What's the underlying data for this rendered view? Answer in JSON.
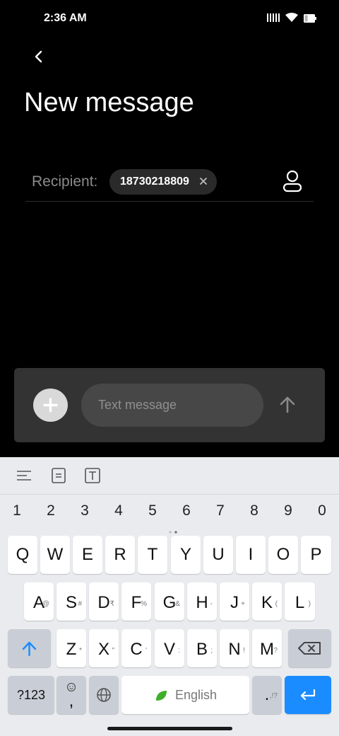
{
  "status_bar": {
    "time": "2:36 AM"
  },
  "header": {
    "title": "New message"
  },
  "recipient": {
    "label": "Recipient:",
    "chip_number": "18730218809"
  },
  "composer": {
    "placeholder": "Text message"
  },
  "keyboard": {
    "numbers": [
      "1",
      "2",
      "3",
      "4",
      "5",
      "6",
      "7",
      "8",
      "9",
      "0"
    ],
    "row1": [
      {
        "key": "Q",
        "hint": ""
      },
      {
        "key": "W",
        "hint": ""
      },
      {
        "key": "E",
        "hint": ""
      },
      {
        "key": "R",
        "hint": ""
      },
      {
        "key": "T",
        "hint": ""
      },
      {
        "key": "Y",
        "hint": ""
      },
      {
        "key": "U",
        "hint": ""
      },
      {
        "key": "I",
        "hint": ""
      },
      {
        "key": "O",
        "hint": ""
      },
      {
        "key": "P",
        "hint": ""
      }
    ],
    "row2": [
      {
        "key": "A",
        "hint": "@"
      },
      {
        "key": "S",
        "hint": "#"
      },
      {
        "key": "D",
        "hint": "₹"
      },
      {
        "key": "F",
        "hint": "%"
      },
      {
        "key": "G",
        "hint": "&"
      },
      {
        "key": "H",
        "hint": "-"
      },
      {
        "key": "J",
        "hint": "+"
      },
      {
        "key": "K",
        "hint": "("
      },
      {
        "key": "L",
        "hint": ")"
      }
    ],
    "row3": [
      {
        "key": "Z",
        "hint": "*"
      },
      {
        "key": "X",
        "hint": "\""
      },
      {
        "key": "C",
        "hint": "'"
      },
      {
        "key": "V",
        "hint": ":"
      },
      {
        "key": "B",
        "hint": ";"
      },
      {
        "key": "N",
        "hint": "!"
      },
      {
        "key": "M",
        "hint": "?"
      }
    ],
    "symbols_label": "?123",
    "comma_label": ",",
    "space_label": "English",
    "period_label": ".",
    "period_hint": ",!?",
    "accent_color": "#1a8cff"
  }
}
